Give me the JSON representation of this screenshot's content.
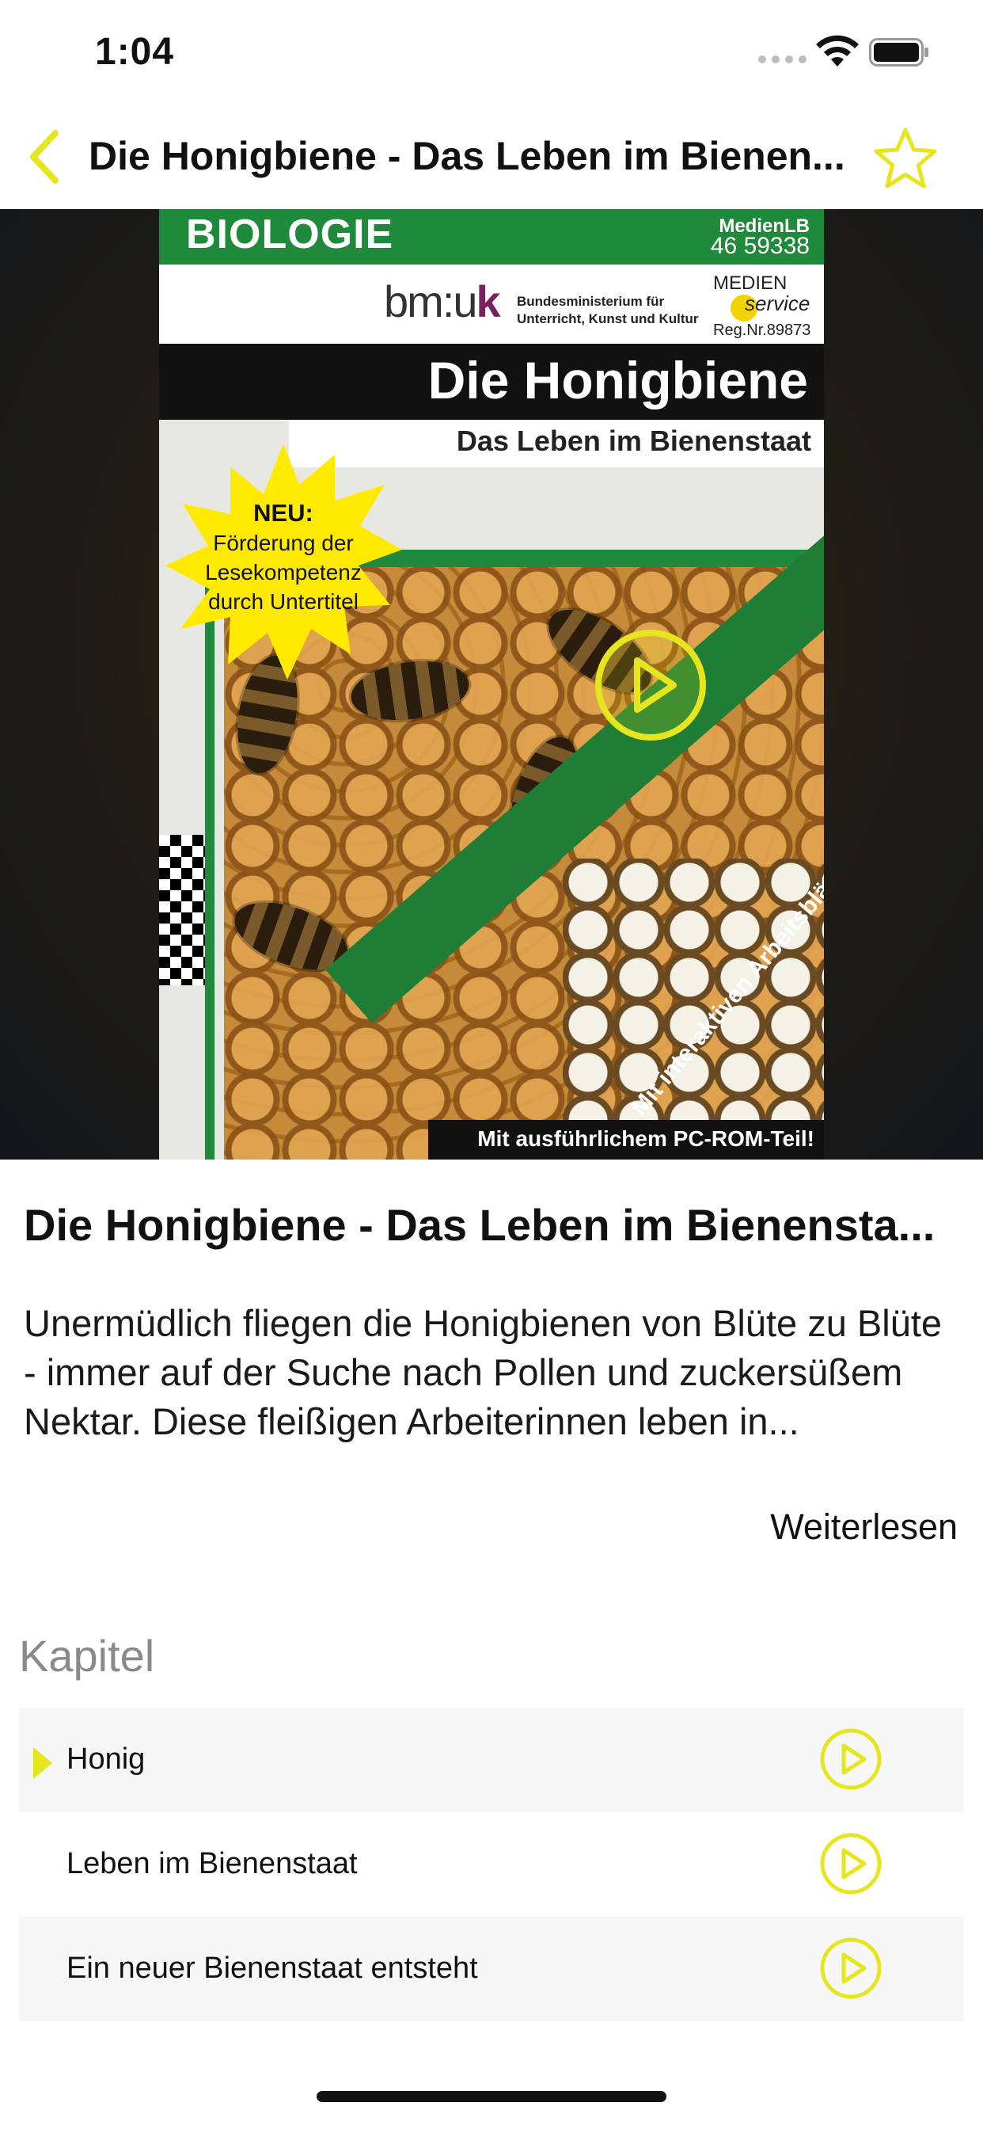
{
  "status_bar": {
    "time": "1:04"
  },
  "nav": {
    "title": "Die Honigbiene - Das Leben im Bienen...",
    "back_icon": "chevron-left-icon",
    "favorite_icon": "star-outline-icon"
  },
  "cover": {
    "subject": "BIOLOGIE",
    "code_label": "MedienLB",
    "code_number": "46 59338",
    "logo_bmuk_prefix": "bm:u",
    "logo_bmuk_suffix": "k",
    "ministry_line1": "Bundesministerium für",
    "ministry_line2": "Unterricht, Kunst und Kultur",
    "medien": "MEDIEN",
    "service": "service",
    "reg": "Reg.Nr.89873",
    "title": "Die Honigbiene",
    "subtitle": "Das Leben im Bienenstaat",
    "burst_head": "NEU:",
    "burst_line1": "Förderung der",
    "burst_line2": "Lesekompetenz",
    "burst_line3": "durch Untertitel",
    "diagonal_text": "Mit interaktiven Arbeitsblättern!",
    "bottom_text": "Mit ausführlichem PC-ROM-Teil!"
  },
  "content": {
    "title": "Die Honigbiene - Das Leben im Bienensta...",
    "description": "Unermüdlich fliegen die Honigbienen von Blüte zu Blüte - immer auf der Suche nach Pollen und zuckersüßem Nektar. Diese fleißigen Arbeiterinnen leben in...",
    "read_more": "Weiterlesen"
  },
  "chapters": {
    "section_title": "Kapitel",
    "items": [
      {
        "label": "Honig",
        "active": true
      },
      {
        "label": "Leben im Bienenstaat",
        "active": false
      },
      {
        "label": "Ein neuer Bienenstaat entsteht",
        "active": false
      }
    ]
  },
  "colors": {
    "accent": "#E6E61E",
    "cover_green": "#1F8A3B"
  }
}
